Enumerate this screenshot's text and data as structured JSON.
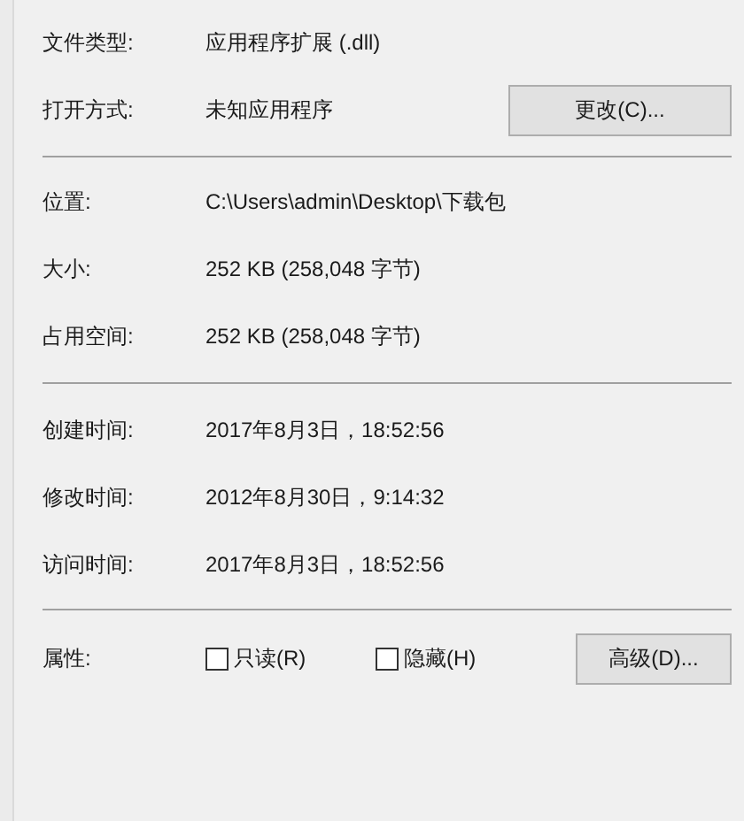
{
  "sections": [
    {
      "rows": [
        {
          "label": "文件类型:",
          "value": "应用程序扩展 (.dll)"
        },
        {
          "label": "打开方式:",
          "value": "未知应用程序",
          "button": "更改(C)..."
        }
      ]
    },
    {
      "rows": [
        {
          "label": "位置:",
          "value": "C:\\Users\\admin\\Desktop\\下载包"
        },
        {
          "label": "大小:",
          "value": "252 KB (258,048 字节)"
        },
        {
          "label": "占用空间:",
          "value": "252 KB (258,048 字节)"
        }
      ]
    },
    {
      "rows": [
        {
          "label": "创建时间:",
          "value": "2017年8月3日，18:52:56"
        },
        {
          "label": "修改时间:",
          "value": "2012年8月30日，9:14:32"
        },
        {
          "label": "访问时间:",
          "value": "2017年8月3日，18:52:56"
        }
      ]
    }
  ],
  "attributes": {
    "label": "属性:",
    "options": [
      {
        "label": "只读(R)",
        "checked": false
      },
      {
        "label": "隐藏(H)",
        "checked": false
      }
    ],
    "button": "高级(D)..."
  }
}
